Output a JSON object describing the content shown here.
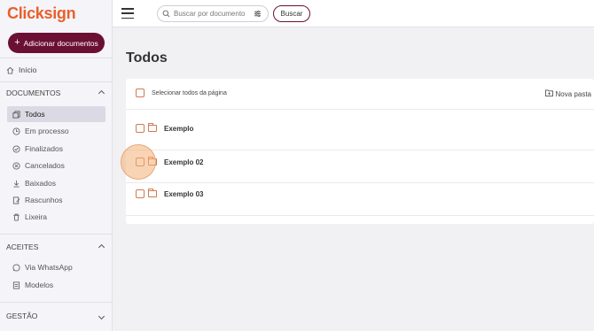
{
  "brand": {
    "logo": "Clicksign",
    "accent": "#6b1033",
    "orange": "#e8602c"
  },
  "sidebar": {
    "add_button": "Adicionar documentos",
    "home": "Início",
    "sections": [
      {
        "title": "DOCUMENTOS",
        "items": [
          {
            "label": "Todos",
            "icon": "documents-icon"
          },
          {
            "label": "Em processo",
            "icon": "clock-icon"
          },
          {
            "label": "Finalizados",
            "icon": "check-circle-icon"
          },
          {
            "label": "Cancelados",
            "icon": "cancel-circle-icon"
          },
          {
            "label": "Baixados",
            "icon": "download-icon"
          },
          {
            "label": "Rascunhos",
            "icon": "draft-icon"
          },
          {
            "label": "Lixeira",
            "icon": "trash-icon"
          }
        ]
      },
      {
        "title": "ACEITES",
        "items": [
          {
            "label": "Via WhatsApp",
            "icon": "whatsapp-icon"
          },
          {
            "label": "Modelos",
            "icon": "template-icon"
          }
        ]
      },
      {
        "title": "GESTÃO",
        "items": []
      }
    ]
  },
  "topbar": {
    "search_placeholder": "Buscar por documento",
    "search_button": "Buscar"
  },
  "main": {
    "title": "Todos",
    "select_all": "Selecionar todos da página",
    "new_folder": "Nova pasta",
    "folders": [
      "Exemplo",
      "Exemplo 02",
      "Exemplo 03"
    ]
  }
}
